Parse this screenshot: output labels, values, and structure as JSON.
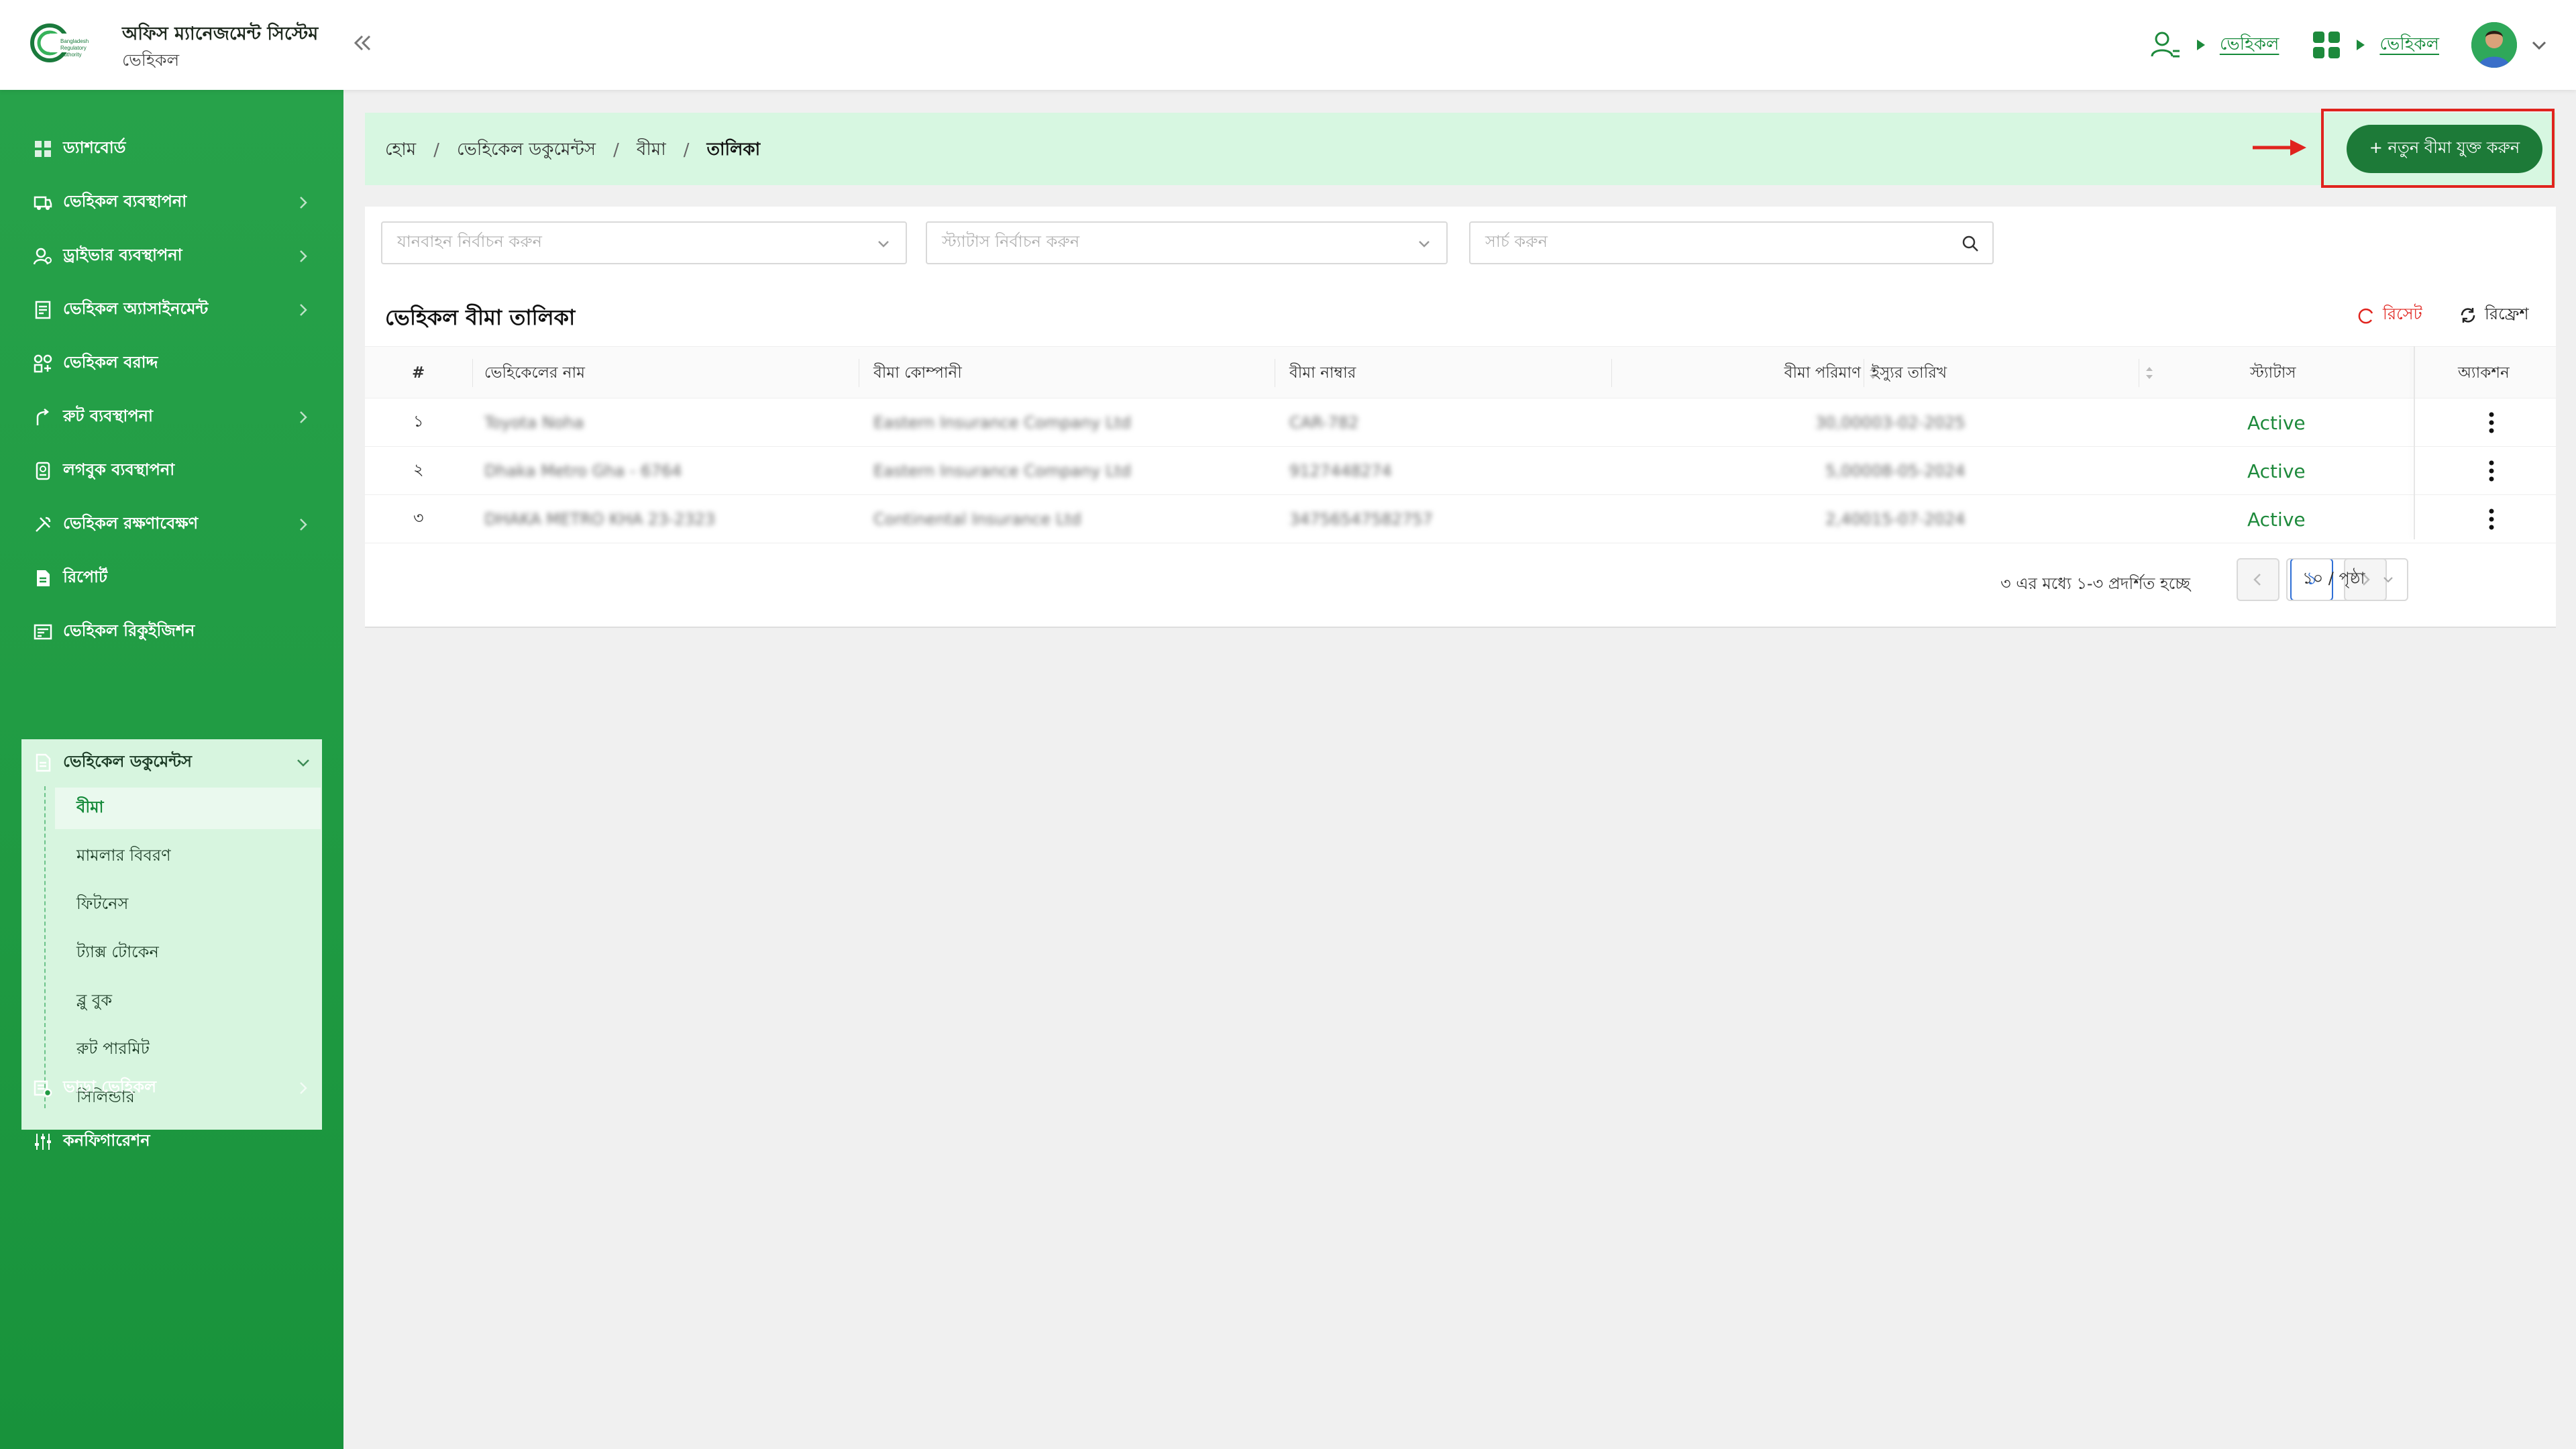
{
  "app": {
    "title": "অফিস ম্যানেজমেন্ট সিস্টেম",
    "subtitle": "ভেহিকল"
  },
  "header": {
    "link_user": "ভেহিকল",
    "link_apps": "ভেহিকল"
  },
  "sidebar": {
    "items": [
      {
        "label": "ড্যাশবোর্ড",
        "icon": "dashboard-icon"
      },
      {
        "label": "ভেহিকল ব্যবস্থাপনা",
        "icon": "vehicle-icon"
      },
      {
        "label": "ড্রাইভার ব্যবস্থাপনা",
        "icon": "driver-icon"
      },
      {
        "label": "ভেহিকল অ্যাসাইনমেন্ট",
        "icon": "assignment-icon"
      },
      {
        "label": "ভেহিকল বরাদ্দ",
        "icon": "allocation-icon"
      },
      {
        "label": "রুট ব্যবস্থাপনা",
        "icon": "route-icon"
      },
      {
        "label": "লগবুক ব্যবস্থাপনা",
        "icon": "logbook-icon"
      },
      {
        "label": "ভেহিকল রক্ষণাবেক্ষণ",
        "icon": "maintenance-icon"
      },
      {
        "label": "রিপোর্ট",
        "icon": "report-icon"
      },
      {
        "label": "ভেহিকল রিকুইজিশন",
        "icon": "requisition-icon"
      }
    ],
    "documents": {
      "label": "ভেহিকেল ডকুমেন্টস",
      "children": [
        "বীমা",
        "মামলার বিবরণ",
        "ফিটনেস",
        "ট্যাক্স টোকেন",
        "ব্লু বুক",
        "রুট পারমিট",
        "সিলিন্ডার"
      ]
    },
    "bottom": [
      {
        "label": "ভাড়া ভেহিকল",
        "icon": "rental-vehicle-icon"
      },
      {
        "label": "কনফিগারেশন",
        "icon": "configuration-icon"
      }
    ]
  },
  "breadcrumb": {
    "home": "হোম",
    "docs": "ভেহিকেল ডকুমেন্টস",
    "insurance": "বীমা",
    "current": "তালিকা"
  },
  "actions": {
    "add_insurance": "+ নতুন বীমা যুক্ত করুন"
  },
  "filters": {
    "vehicle_placeholder": "যানবাহন নির্বাচন করুন",
    "status_placeholder": "স্ট্যাটাস নির্বাচন করুন",
    "search_placeholder": "সার্চ করুন"
  },
  "table": {
    "title": "ভেহিকল বীমা তালিকা",
    "reset": "রিসেট",
    "refresh": "রিফ্রেশ",
    "columns": [
      "#",
      "ভেহিকেলের নাম",
      "বীমা কোম্পানী",
      "বীমা নাম্বার",
      "বীমা পরিমাণ",
      "ইস্যুর তারিখ",
      "স্ট্যাটাস",
      "অ্যাকশন"
    ],
    "rows": [
      {
        "no": "১",
        "vehicle": "Toyota Noha",
        "company": "Eastern Insurance Company Ltd",
        "number": "CAR-782",
        "amount": "30,000",
        "date": "03-02-2025",
        "status": "Active"
      },
      {
        "no": "২",
        "vehicle": "Dhaka Metro Gha - 6764",
        "company": "Eastern Insurance Company Ltd",
        "number": "9127448274",
        "amount": "5,000",
        "date": "08-05-2024",
        "status": "Active"
      },
      {
        "no": "৩",
        "vehicle": "DHAKA METRO KHA 23-2323",
        "company": "Continental Insurance Ltd",
        "number": "34756547582757",
        "amount": "2,400",
        "date": "15-07-2024",
        "status": "Active"
      }
    ]
  },
  "pagination": {
    "summary": "৩ এর মধ্যে ১-৩ প্রদর্শিত হচ্ছে",
    "current_page": "১",
    "page_size": "১০ / পৃষ্ঠা"
  },
  "colors": {
    "brand_green": "#1d7a38",
    "sidebar_green": "#27a24a",
    "highlight_red": "#e0241e",
    "status_green": "#1e8a3c"
  }
}
